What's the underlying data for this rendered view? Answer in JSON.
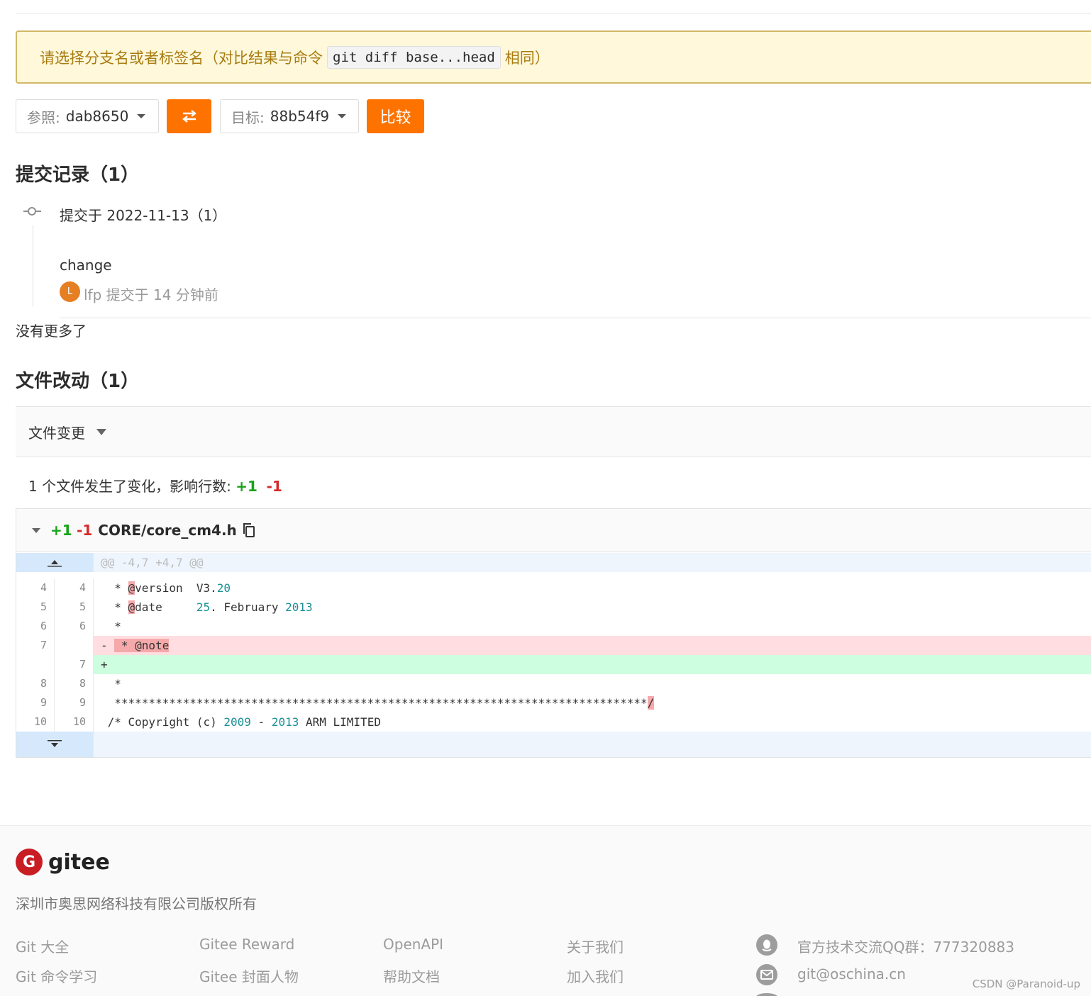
{
  "notice": {
    "prefix": "请选择分支名或者标签名（对比结果与命令",
    "command": "git diff base...head",
    "suffix": "相同）"
  },
  "compare": {
    "base_label": "参照:",
    "base_value": "dab8650",
    "swap_icon": "swap-arrows-icon",
    "target_label": "目标:",
    "target_value": "88b54f9",
    "compare_button": "比较"
  },
  "commits": {
    "heading": "提交记录（1）",
    "date_group": "提交于 2022-11-13（1）",
    "items": [
      {
        "message": "change",
        "avatar_letter": "L",
        "meta": "lfp 提交于 14 分钟前"
      }
    ],
    "no_more": "没有更多了"
  },
  "files": {
    "heading": "文件改动（1）",
    "dropdown_label": "文件变更",
    "summary_prefix": "1 个文件发生了变化，影响行数:",
    "summary_add": "+1",
    "summary_del": "-1"
  },
  "diff": {
    "add": "+1",
    "del": "-1",
    "filename": "CORE/core_cm4.h",
    "hunk": "@@ -4,7 +4,7 @@",
    "lines": [
      {
        "old": "4",
        "new": "4",
        "type": "ctx",
        "text": "  * @version  V3.20"
      },
      {
        "old": "5",
        "new": "5",
        "type": "ctx",
        "text": "  * @date     25. February 2013"
      },
      {
        "old": "6",
        "new": "6",
        "type": "ctx",
        "text": "  *"
      },
      {
        "old": "7",
        "new": "",
        "type": "del",
        "text": "-  * @note"
      },
      {
        "old": "",
        "new": "7",
        "type": "add",
        "text": "+"
      },
      {
        "old": "8",
        "new": "8",
        "type": "ctx",
        "text": "  *"
      },
      {
        "old": "9",
        "new": "9",
        "type": "ctx",
        "text": "  ******************************************************************************/"
      },
      {
        "old": "10",
        "new": "10",
        "type": "ctx",
        "text": " /* Copyright (c) 2009 - 2013 ARM LIMITED"
      }
    ]
  },
  "footer": {
    "logo_text": "gitee",
    "copyright": "深圳市奥思网络科技有限公司版权所有",
    "col1": [
      "Git 大全",
      "Git 命令学习"
    ],
    "col2": [
      "Gitee Reward",
      "Gitee 封面人物"
    ],
    "col3": [
      "OpenAPI",
      "帮助文档"
    ],
    "col4": [
      "关于我们",
      "加入我们"
    ],
    "qq": "官方技术交流QQ群：777320883",
    "email": "git@oschina.cn",
    "watermark": "CSDN @Paranoid-up"
  },
  "colors": {
    "accent": "#fe7300",
    "add": "#1aa31a",
    "del": "#d62a2a",
    "brand": "#c71d23"
  }
}
